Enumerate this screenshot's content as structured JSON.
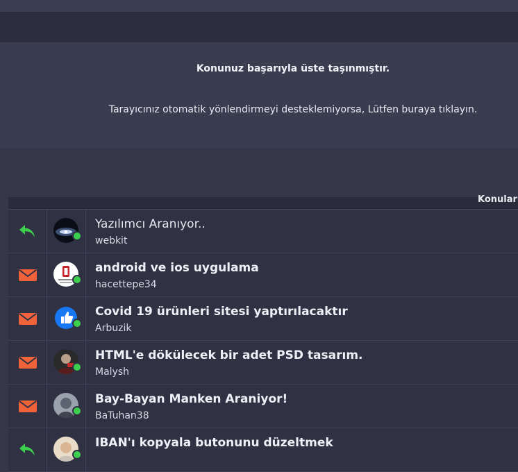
{
  "redirect": {
    "title": "Konunuz başarıyla üste taşınmıştır.",
    "message": "Tarayıcınız otomatik yönlendirmeyi desteklemiyorsa, Lütfen buraya tıklayın."
  },
  "list": {
    "header_label": "Konuları",
    "rows": [
      {
        "title": "Yazılımcı Aranıyor..",
        "author": "webkit",
        "state_icon": "reply-icon",
        "avatar": "webkit-avatar"
      },
      {
        "title": "android ve ios uygulama",
        "author": "hacettepe34",
        "state_icon": "envelope-icon",
        "avatar": "hacettepe-avatar"
      },
      {
        "title": "Covid 19 ürünleri sitesi yaptırılacaktır",
        "author": "Arbuzik",
        "state_icon": "envelope-icon",
        "avatar": "like-avatar"
      },
      {
        "title": "HTML'e dökülecek bir adet PSD tasarım.",
        "author": "Malysh",
        "state_icon": "envelope-icon",
        "avatar": "malysh-avatar"
      },
      {
        "title": "Bay-Bayan Manken Araniyor!",
        "author": "BaTuhan38",
        "state_icon": "envelope-icon",
        "avatar": "batuhan-avatar"
      },
      {
        "title": "IBAN'ı kopyala butonunu düzeltmek",
        "author": "",
        "state_icon": "reply-icon",
        "avatar": "user-avatar"
      }
    ]
  },
  "colors": {
    "reply": "#3ccf4e",
    "envelope": "#f0623a",
    "online": "#3ccf4e"
  }
}
